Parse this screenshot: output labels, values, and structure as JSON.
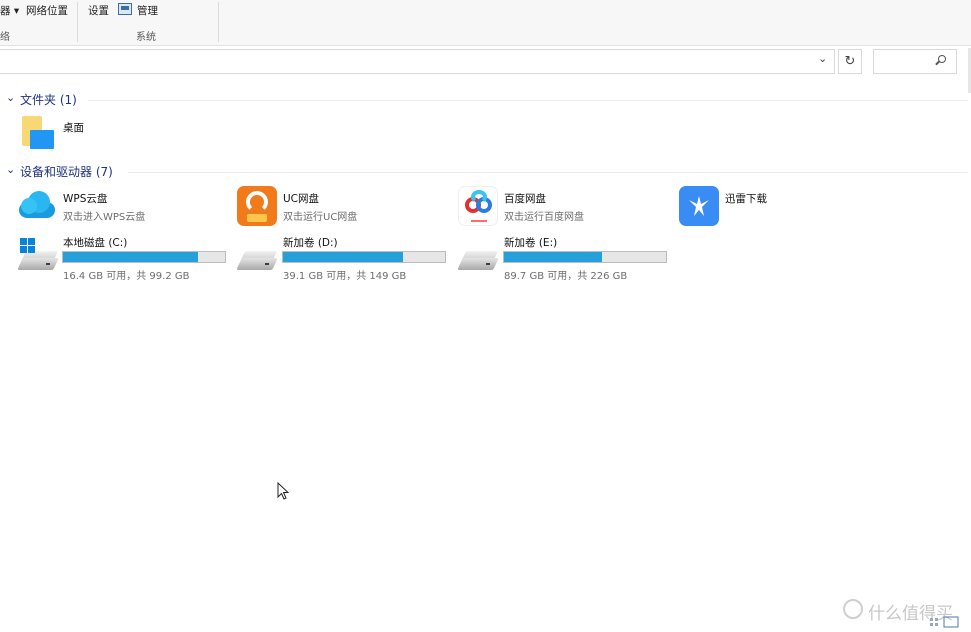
{
  "ribbon": {
    "items": [
      {
        "label": "器 ▾"
      },
      {
        "label": "网络位置"
      },
      {
        "label": "设置"
      },
      {
        "label": "管理"
      }
    ],
    "groups": [
      {
        "label": "络"
      },
      {
        "label": "系统"
      }
    ]
  },
  "address": {
    "value": "",
    "dropdown_icon": "chevron-down-icon",
    "refresh_icon": "refresh-icon"
  },
  "search": {
    "placeholder": "",
    "icon": "search-icon"
  },
  "sections": {
    "folders": {
      "title": "文件夹 (1)",
      "chevron": "chevron-down-icon"
    },
    "devices": {
      "title": "设备和驱动器 (7)",
      "chevron": "chevron-down-icon"
    }
  },
  "folders": [
    {
      "name": "桌面",
      "icon": "desktop-folder-icon"
    }
  ],
  "apps": [
    {
      "name": "WPS云盘",
      "subtitle": "双击进入WPS云盘",
      "icon": "wps-cloud-icon"
    },
    {
      "name": "UC网盘",
      "subtitle": "双击运行UC网盘",
      "icon": "uc-drive-icon"
    },
    {
      "name": "百度网盘",
      "subtitle": "双击运行百度网盘",
      "icon": "baidu-netdisk-icon"
    },
    {
      "name": "迅雷下载",
      "subtitle": "",
      "icon": "xunlei-icon"
    }
  ],
  "drives": [
    {
      "name": "本地磁盘 (C:)",
      "usage": "16.4 GB 可用，共 99.2 GB",
      "used_fraction": 0.835,
      "icon": "windows-drive-icon"
    },
    {
      "name": "新加卷 (D:)",
      "usage": "39.1 GB 可用，共 149 GB",
      "used_fraction": 0.738,
      "icon": "drive-icon"
    },
    {
      "name": "新加卷 (E:)",
      "usage": "89.7 GB 可用，共 226 GB",
      "used_fraction": 0.603,
      "icon": "drive-icon"
    }
  ],
  "colors": {
    "accent": "#26a0da",
    "section_title": "#1e3287"
  },
  "watermark": {
    "text": "什么值得买"
  }
}
